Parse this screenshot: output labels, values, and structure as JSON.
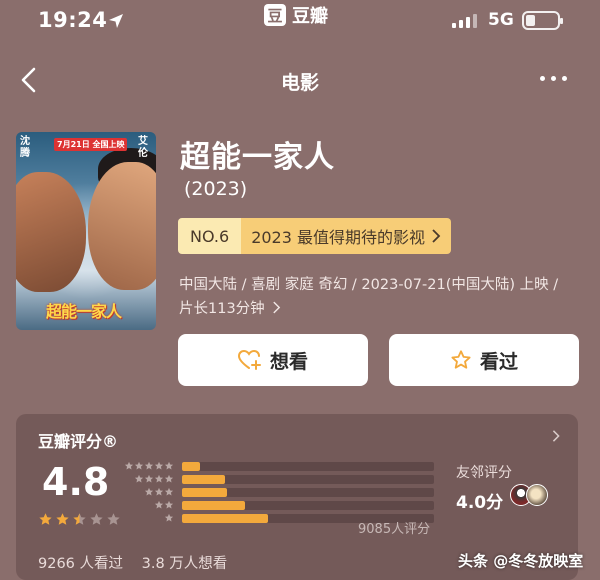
{
  "status_bar": {
    "time": "19:24",
    "network": "5G",
    "brand_icon": "豆",
    "brand_text": "豆瓣"
  },
  "nav": {
    "title": "电影"
  },
  "poster": {
    "cast_left": "沈腾",
    "cast_right": "艾伦",
    "date_badge": "7月21日 全国上映",
    "title_art": "超能一家人"
  },
  "movie": {
    "title": "超能一家人",
    "year": "(2023)",
    "rank_no": "NO.6",
    "rank_text": "2023 最值得期待的影视",
    "meta": "中国大陆 / 喜剧 家庭 奇幻 / 2023-07-21(中国大陆) 上映 / 片长113分钟"
  },
  "actions": {
    "want": "想看",
    "seen": "看过"
  },
  "rating": {
    "title": "豆瓣评分®",
    "score": "4.8",
    "star_level": 2.5,
    "distribution": [
      {
        "stars": 5,
        "fraction": 0.07
      },
      {
        "stars": 4,
        "fraction": 0.17
      },
      {
        "stars": 3,
        "fraction": 0.18
      },
      {
        "stars": 2,
        "fraction": 0.25
      },
      {
        "stars": 1,
        "fraction": 0.34
      }
    ],
    "votes": "9085人评分",
    "friend_label": "友邻评分",
    "friend_score": "4.0分",
    "seen_count": "9266 人看过",
    "want_count": "3.8 万人想看"
  },
  "colors": {
    "background": "#8a6e6c",
    "accent": "#f3a93c",
    "rank_bg": "#f7cd77"
  },
  "watermark": "头条 @冬冬放映室"
}
